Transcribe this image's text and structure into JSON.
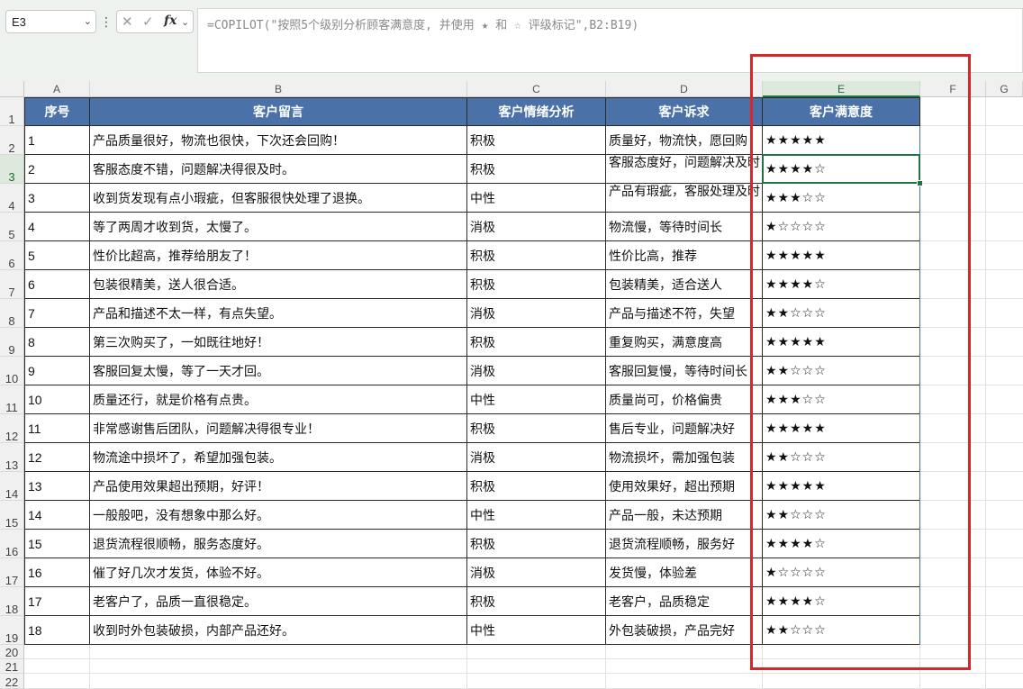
{
  "name_box": {
    "value": "E3"
  },
  "formula_bar": {
    "cancel_symbol": "✕",
    "enter_symbol": "✓",
    "fx_label": "fx",
    "formula": "=COPILOT(\"按照5个级别分析顾客满意度, 并使用 ★ 和 ☆ 评级标记\",B2:B19)"
  },
  "columns": [
    "A",
    "B",
    "C",
    "D",
    "E",
    "F",
    "G"
  ],
  "selected_column": "E",
  "row_numbers": [
    "1",
    "2",
    "3",
    "4",
    "5",
    "6",
    "7",
    "8",
    "9",
    "10",
    "11",
    "12",
    "13",
    "14",
    "15",
    "16",
    "17",
    "18",
    "19",
    "20",
    "21",
    "22"
  ],
  "selected_row": "3",
  "table": {
    "headers": [
      "序号",
      "客户留言",
      "客户情绪分析",
      "客户诉求",
      "客户满意度"
    ],
    "rows": [
      [
        "1",
        "产品质量很好，物流也很快，下次还会回购！",
        "积极",
        "质量好，物流快，愿回购",
        "★★★★★"
      ],
      [
        "2",
        "客服态度不错，问题解决得很及时。",
        "积极",
        "客服态度好，问题解决及时",
        "★★★★☆"
      ],
      [
        "3",
        "收到货发现有点小瑕疵，但客服很快处理了退换。",
        "中性",
        "产品有瑕疵，客服处理及时",
        "★★★☆☆"
      ],
      [
        "4",
        "等了两周才收到货，太慢了。",
        "消极",
        "物流慢，等待时间长",
        "★☆☆☆☆"
      ],
      [
        "5",
        "性价比超高，推荐给朋友了！",
        "积极",
        "性价比高，推荐",
        "★★★★★"
      ],
      [
        "6",
        "包装很精美，送人很合适。",
        "积极",
        "包装精美，适合送人",
        "★★★★☆"
      ],
      [
        "7",
        "产品和描述不太一样，有点失望。",
        "消极",
        "产品与描述不符，失望",
        "★★☆☆☆"
      ],
      [
        "8",
        "第三次购买了，一如既往地好！",
        "积极",
        "重复购买，满意度高",
        "★★★★★"
      ],
      [
        "9",
        "客服回复太慢，等了一天才回。",
        "消极",
        "客服回复慢，等待时间长",
        "★★☆☆☆"
      ],
      [
        "10",
        "质量还行，就是价格有点贵。",
        "中性",
        "质量尚可，价格偏贵",
        "★★★☆☆"
      ],
      [
        "11",
        "非常感谢售后团队，问题解决得很专业！",
        "积极",
        "售后专业，问题解决好",
        "★★★★★"
      ],
      [
        "12",
        "物流途中损坏了，希望加强包装。",
        "消极",
        "物流损坏，需加强包装",
        "★★☆☆☆"
      ],
      [
        "13",
        "产品使用效果超出预期，好评！",
        "积极",
        "使用效果好，超出预期",
        "★★★★★"
      ],
      [
        "14",
        "一般般吧，没有想象中那么好。",
        "中性",
        "产品一般，未达预期",
        "★★☆☆☆"
      ],
      [
        "15",
        "退货流程很顺畅，服务态度好。",
        "积极",
        "退货流程顺畅，服务好",
        "★★★★☆"
      ],
      [
        "16",
        "催了好几次才发货，体验不好。",
        "消极",
        "发货慢，体验差",
        "★☆☆☆☆"
      ],
      [
        "17",
        "老客户了，品质一直很稳定。",
        "积极",
        "老客户，品质稳定",
        "★★★★☆"
      ],
      [
        "18",
        "收到时外包装破损，内部产品还好。",
        "中性",
        "外包装破损，产品完好",
        "★★☆☆☆"
      ]
    ]
  },
  "colors": {
    "header_fill": "#4a72a8",
    "header_text": "#ffffff",
    "selection": "#217346",
    "highlight_box": "#d9262b"
  }
}
